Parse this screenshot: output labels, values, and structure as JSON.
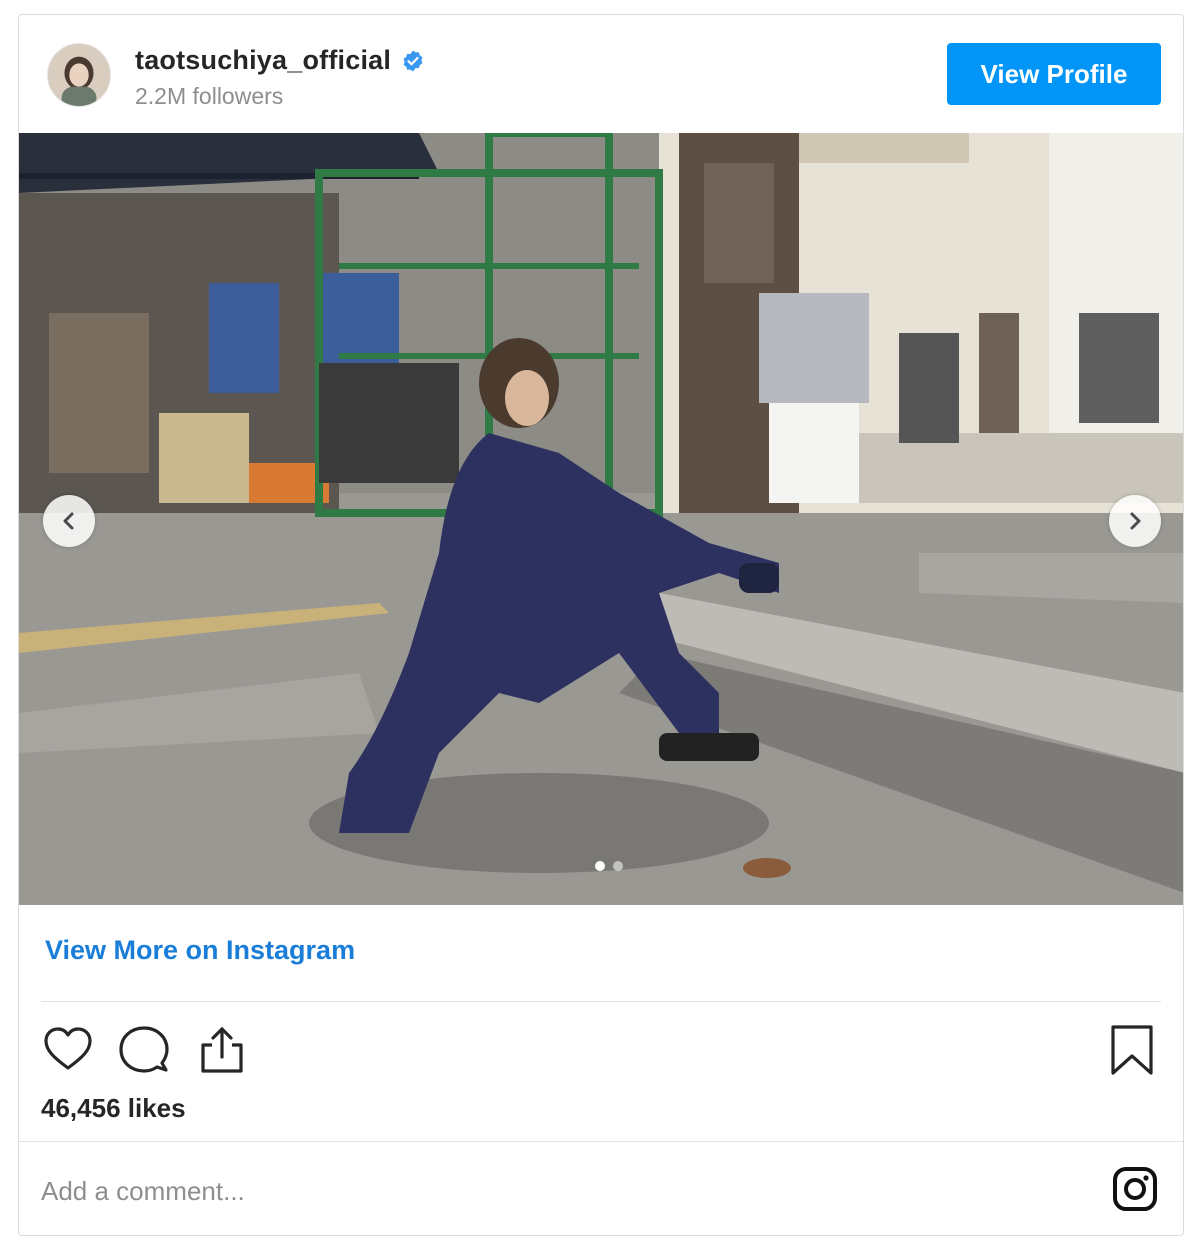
{
  "header": {
    "username": "taotsuchiya_official",
    "followers": "2.2M followers",
    "view_profile_label": "View Profile"
  },
  "media": {
    "slide_count": 2,
    "active_slide": 1
  },
  "links": {
    "view_more": "View More on Instagram"
  },
  "stats": {
    "likes": "46,456 likes"
  },
  "comment": {
    "placeholder": "Add a comment..."
  },
  "colors": {
    "accent": "#0095f6",
    "link": "#1a7ed8",
    "verified": "#3897f0"
  },
  "icons": [
    "verified-icon",
    "chevron-left-icon",
    "chevron-right-icon",
    "heart-icon",
    "comment-icon",
    "share-icon",
    "bookmark-icon",
    "instagram-icon"
  ]
}
